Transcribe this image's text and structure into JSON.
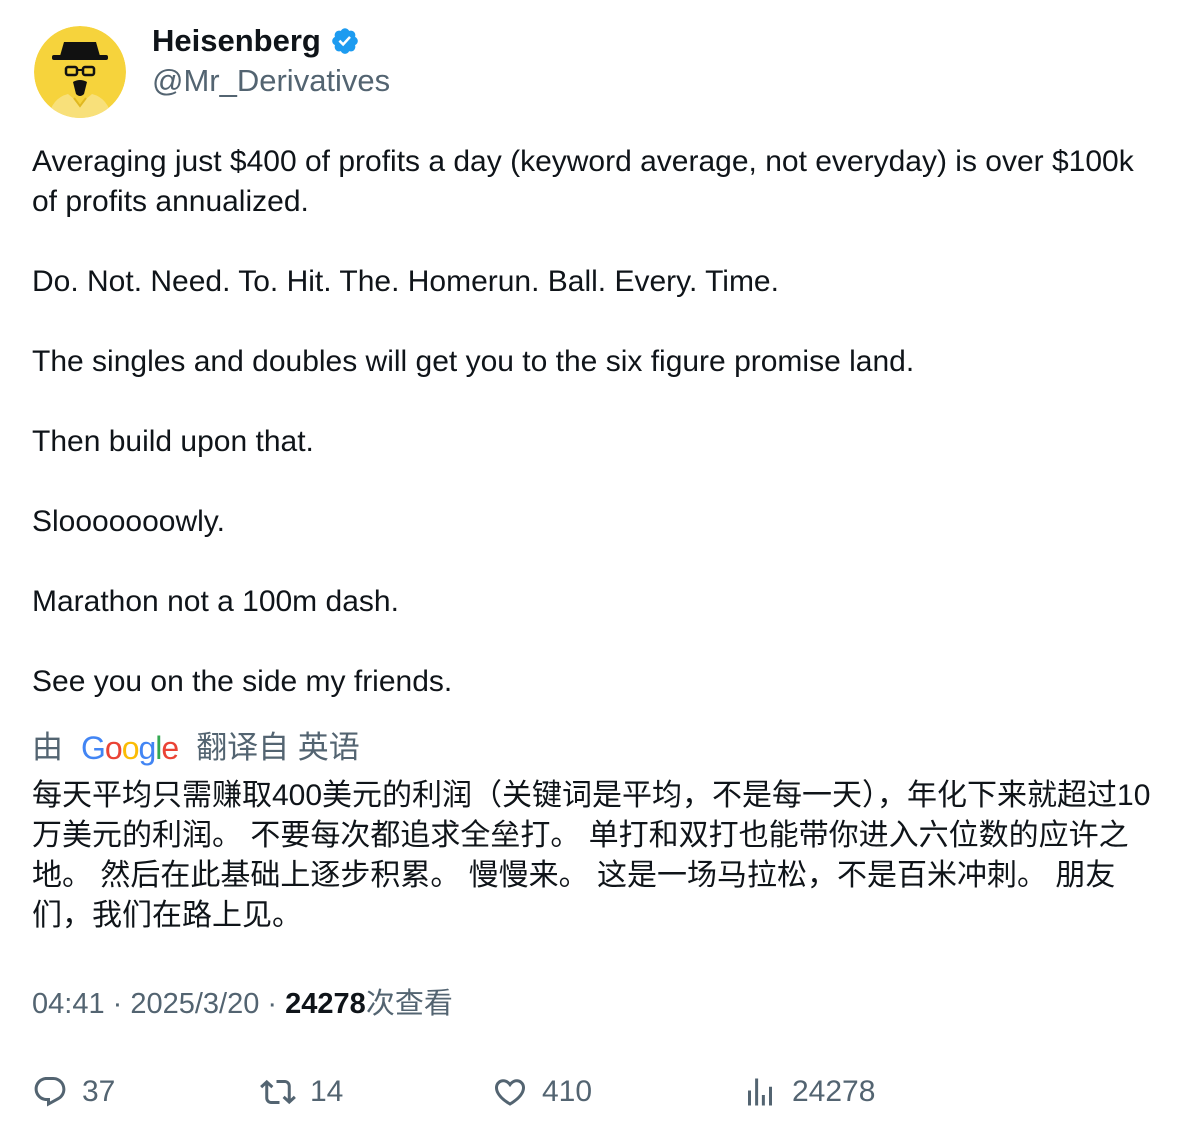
{
  "author": {
    "display_name": "Heisenberg",
    "handle": "@Mr_Derivatives",
    "avatar_icon": "heisenberg-avatar-icon",
    "verified_icon": "verified-badge-icon",
    "verified_color": "#1d9bf0"
  },
  "tweet": {
    "paragraphs": [
      "Averaging just $400 of profits a day (keyword average, not everyday) is over $100k of profits annualized.",
      "Do. Not. Need. To. Hit. The. Homerun. Ball. Every. Time.",
      "The singles and doubles will get you to the six figure promise land.",
      "Then build upon that.",
      "Slooooooowly.",
      "Marathon not a 100m dash.",
      "See you on the side my friends."
    ]
  },
  "translation": {
    "prefix": "由",
    "provider": "Google",
    "suffix": "翻译自 英语",
    "text": "每天平均只需赚取400美元的利润（关键词是平均，不是每一天），年化下来就超过10万美元的利润。 不要每次都追求全垒打。 单打和双打也能带你进入六位数的应许之地。 然后在此基础上逐步积累。 慢慢来。 这是一场马拉松，不是百米冲刺。 朋友们，我们在路上见。"
  },
  "meta": {
    "time": "04:41",
    "separator": " · ",
    "date": "2025/3/20",
    "views_count": "24278",
    "views_label": "次查看"
  },
  "actions": {
    "reply": {
      "icon": "reply-icon",
      "count": "37"
    },
    "retweet": {
      "icon": "retweet-icon",
      "count": "14"
    },
    "like": {
      "icon": "heart-icon",
      "count": "410"
    },
    "views": {
      "icon": "analytics-icon",
      "count": "24278"
    }
  },
  "colors": {
    "text_primary": "#0f1419",
    "text_secondary": "#536471",
    "background": "#ffffff"
  }
}
